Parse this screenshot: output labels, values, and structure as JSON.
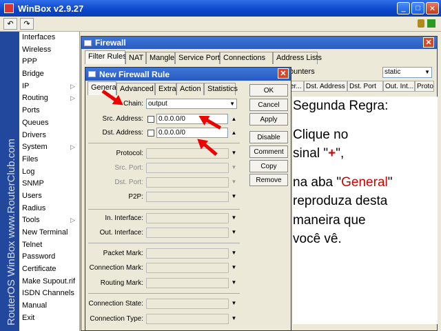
{
  "app": {
    "title": "WinBox v2.9.27"
  },
  "sidebar": {
    "brand_vertical": "RouterOS WinBox   www.RouterClub.com",
    "items": [
      {
        "label": "Interfaces"
      },
      {
        "label": "Wireless"
      },
      {
        "label": "PPP"
      },
      {
        "label": "Bridge"
      },
      {
        "label": "IP",
        "sub": true
      },
      {
        "label": "Routing",
        "sub": true
      },
      {
        "label": "Ports"
      },
      {
        "label": "Queues"
      },
      {
        "label": "Drivers"
      },
      {
        "label": "System",
        "sub": true
      },
      {
        "label": "Files"
      },
      {
        "label": "Log"
      },
      {
        "label": "SNMP"
      },
      {
        "label": "Users"
      },
      {
        "label": "Radius"
      },
      {
        "label": "Tools",
        "sub": true
      },
      {
        "label": "New Terminal"
      },
      {
        "label": "Telnet"
      },
      {
        "label": "Password"
      },
      {
        "label": "Certificate"
      },
      {
        "label": "Make Supout.rif"
      },
      {
        "label": "ISDN Channels"
      },
      {
        "label": "Manual"
      },
      {
        "label": "Exit"
      }
    ]
  },
  "firewall": {
    "title": "Firewall",
    "tabs": [
      "Filter Rules",
      "NAT",
      "Mangle",
      "Service Ports",
      "Connections",
      "Address Lists"
    ],
    "counters_label": "ounters",
    "filter_select": "static",
    "columns": [
      "er...",
      "Dst. Address",
      "Dst. Port",
      "Out. Int...",
      "Proto."
    ]
  },
  "rule": {
    "title": "New Firewall Rule",
    "tabs": [
      "General",
      "Advanced",
      "Extra",
      "Action",
      "Statistics"
    ],
    "buttons": [
      "OK",
      "Cancel",
      "Apply",
      "Disable",
      "Comment",
      "Copy",
      "Remove"
    ],
    "chain_label": "Chain:",
    "chain_value": "output",
    "src_label": "Src. Address:",
    "src_value": "0.0.0.0/0",
    "dst_label": "Dst. Address:",
    "dst_value": "0.0.0.0/0",
    "protocol_label": "Protocol:",
    "src_port_label": "Src. Port:",
    "dst_port_label": "Dst. Port:",
    "p2p_label": "P2P:",
    "in_iface_label": "In. Interface:",
    "out_iface_label": "Out. Interface:",
    "packet_mark_label": "Packet Mark:",
    "conn_mark_label": "Connection Mark:",
    "routing_mark_label": "Routing Mark:",
    "conn_state_label": "Connection State:",
    "conn_type_label": "Connection Type:"
  },
  "instructions": {
    "line1": "Segunda Regra:",
    "line2a": "Clique no",
    "line2b": "sinal \"",
    "plus": "+",
    "line2c": "\",",
    "line3a": "na aba \"",
    "general": "General",
    "line3b": "\"",
    "line3c": "reproduza desta",
    "line3d": "maneira que",
    "line3e": "você vê."
  },
  "colors": {
    "accent": "#d00000",
    "titlebar": "#0a46c9"
  }
}
